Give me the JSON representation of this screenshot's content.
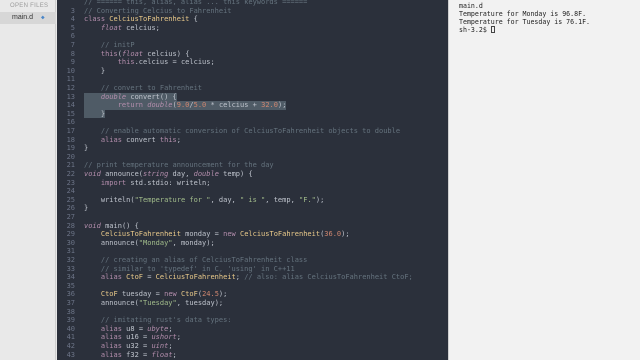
{
  "sidebar": {
    "header": "OPEN FILES",
    "files": [
      {
        "name": "main.d"
      }
    ]
  },
  "terminal": {
    "lines": [
      "main.d",
      "Temperature for Monday is 96.8F.",
      "Temperature for Tuesday is 76.1F.",
      "sh-3.2$ "
    ]
  },
  "editor": {
    "lines": [
      {
        "num": "",
        "text": "// ====== this, alias, alias ... this keywords ======",
        "cls": "c"
      },
      {
        "num": "3",
        "text": "// Converting Celcius to Fahrenheit",
        "cls": "c"
      },
      {
        "num": "4",
        "text": "class CelciusToFahrenheit {",
        "cls": ""
      },
      {
        "num": "5",
        "text": "    float celcius;",
        "cls": ""
      },
      {
        "num": "6",
        "text": "",
        "cls": ""
      },
      {
        "num": "7",
        "text": "    // initP",
        "cls": "c"
      },
      {
        "num": "8",
        "text": "    this(float celcius) {",
        "cls": ""
      },
      {
        "num": "9",
        "text": "        this.celcius = celcius;",
        "cls": ""
      },
      {
        "num": "10",
        "text": "    }",
        "cls": ""
      },
      {
        "num": "11",
        "text": "",
        "cls": ""
      },
      {
        "num": "12",
        "text": "    // convert to Fahrenheit",
        "cls": "c"
      },
      {
        "num": "13",
        "text": "    double convert() {",
        "cls": ""
      },
      {
        "num": "14",
        "text": "        return double(9.0/5.0 * celcius + 32.0);",
        "cls": ""
      },
      {
        "num": "15",
        "text": "    }",
        "cls": ""
      },
      {
        "num": "16",
        "text": "",
        "cls": ""
      },
      {
        "num": "17",
        "text": "    // enable automatic conversion of CelciusToFahrenheit objects to double",
        "cls": "c"
      },
      {
        "num": "18",
        "text": "    alias convert this;",
        "cls": ""
      },
      {
        "num": "19",
        "text": "}",
        "cls": ""
      },
      {
        "num": "20",
        "text": "",
        "cls": ""
      },
      {
        "num": "21",
        "text": "// print temperature announcement for the day",
        "cls": "c"
      },
      {
        "num": "22",
        "text": "void announce(string day, double temp) {",
        "cls": ""
      },
      {
        "num": "23",
        "text": "    import std.stdio: writeln;",
        "cls": ""
      },
      {
        "num": "24",
        "text": "",
        "cls": ""
      },
      {
        "num": "25",
        "text": "    writeln(\"Temperature for \", day, \" is \", temp, \"F.\");",
        "cls": ""
      },
      {
        "num": "26",
        "text": "}",
        "cls": ""
      },
      {
        "num": "27",
        "text": "",
        "cls": ""
      },
      {
        "num": "28",
        "text": "void main() {",
        "cls": ""
      },
      {
        "num": "29",
        "text": "    CelciusToFahrenheit monday = new CelciusToFahrenheit(36.0);",
        "cls": ""
      },
      {
        "num": "30",
        "text": "    announce(\"Monday\", monday);",
        "cls": ""
      },
      {
        "num": "31",
        "text": "",
        "cls": ""
      },
      {
        "num": "32",
        "text": "    // creating an alias of CelciusToFahrenheit class",
        "cls": "c"
      },
      {
        "num": "33",
        "text": "    // similar to 'typedef' in C, 'using' in C++11",
        "cls": "c"
      },
      {
        "num": "34",
        "text": "    alias CtoF = CelciusToFahrenheit; // also: alias CelciusToFahrenheit CtoF;",
        "cls": ""
      },
      {
        "num": "35",
        "text": "",
        "cls": ""
      },
      {
        "num": "36",
        "text": "    CtoF tuesday = new CtoF(24.5);",
        "cls": ""
      },
      {
        "num": "37",
        "text": "    announce(\"Tuesday\", tuesday);",
        "cls": ""
      },
      {
        "num": "38",
        "text": "",
        "cls": ""
      },
      {
        "num": "39",
        "text": "    // imitating rust's data types:",
        "cls": "c"
      },
      {
        "num": "40",
        "text": "    alias u8 = ubyte;",
        "cls": ""
      },
      {
        "num": "41",
        "text": "    alias u16 = ushort;",
        "cls": ""
      },
      {
        "num": "42",
        "text": "    alias u32 = uint;",
        "cls": ""
      },
      {
        "num": "43",
        "text": "    alias f32 = float;",
        "cls": ""
      }
    ]
  }
}
